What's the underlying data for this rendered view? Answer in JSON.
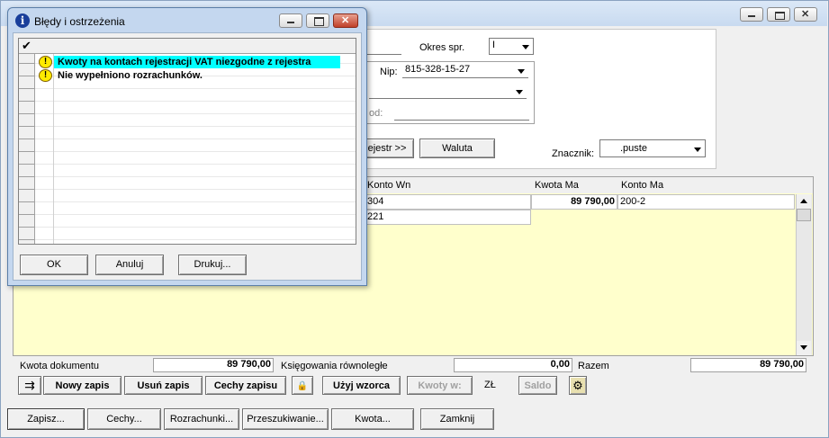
{
  "main": {
    "okres_label": "Okres spr.",
    "okres_value": "I",
    "nip_label": "Nip:",
    "nip_value": "815-328-15-27",
    "kod_label": "od:",
    "rejestr_button": "ejestr >>",
    "waluta_button": "Waluta",
    "znacznik_label": "Znacznik:",
    "znacznik_value": ".puste",
    "grid": {
      "headers": {
        "konto_wn": "Konto Wn",
        "kwota_ma": "Kwota Ma",
        "konto_ma": "Konto Ma"
      },
      "rows": [
        {
          "konto_wn": "304",
          "kwota_ma": "89 790,00",
          "konto_ma": "200-2"
        },
        {
          "konto_wn": "221",
          "kwota_ma": "",
          "konto_ma": ""
        }
      ]
    },
    "totals": {
      "kwota_dokumentu_label": "Kwota dokumentu",
      "kwota_dokumentu_value": "89 790,00",
      "ksiegowania_label": "Księgowania równoległe",
      "ksiegowania_value": "0,00",
      "razem_label": "Razem",
      "razem_value": "89 790,00"
    },
    "toolbar": {
      "nowy_zapis": "Nowy zapis",
      "usun_zapis": "Usuń zapis",
      "cechy_zapisu": "Cechy zapisu",
      "uzyj_wzorca": "Użyj wzorca",
      "kwoty_w": "Kwoty w:",
      "currency": "ZŁ",
      "saldo": "Saldo"
    },
    "bottom_buttons": {
      "zapisz": "Zapisz...",
      "cechy": "Cechy...",
      "rozrachunki": "Rozrachunki...",
      "przeszukiwanie": "Przeszukiwanie...",
      "kwota": "Kwota...",
      "zamknij": "Zamknij"
    }
  },
  "dialog": {
    "title": "Błędy i ostrzeżenia",
    "messages": [
      {
        "text": "Kwoty na kontach rejestracji VAT niezgodne z rejestra",
        "selected": true
      },
      {
        "text": "Nie wypełniono rozrachunków.",
        "selected": false
      }
    ],
    "buttons": {
      "ok": "OK",
      "anuluj": "Anuluj",
      "drukuj": "Drukuj..."
    }
  },
  "colors": {
    "grid_bg": "#ffffcc",
    "selected_row": "#00ffff",
    "window_bg": "#f0f0f0",
    "title_gradient_top": "#dbe8f7"
  }
}
